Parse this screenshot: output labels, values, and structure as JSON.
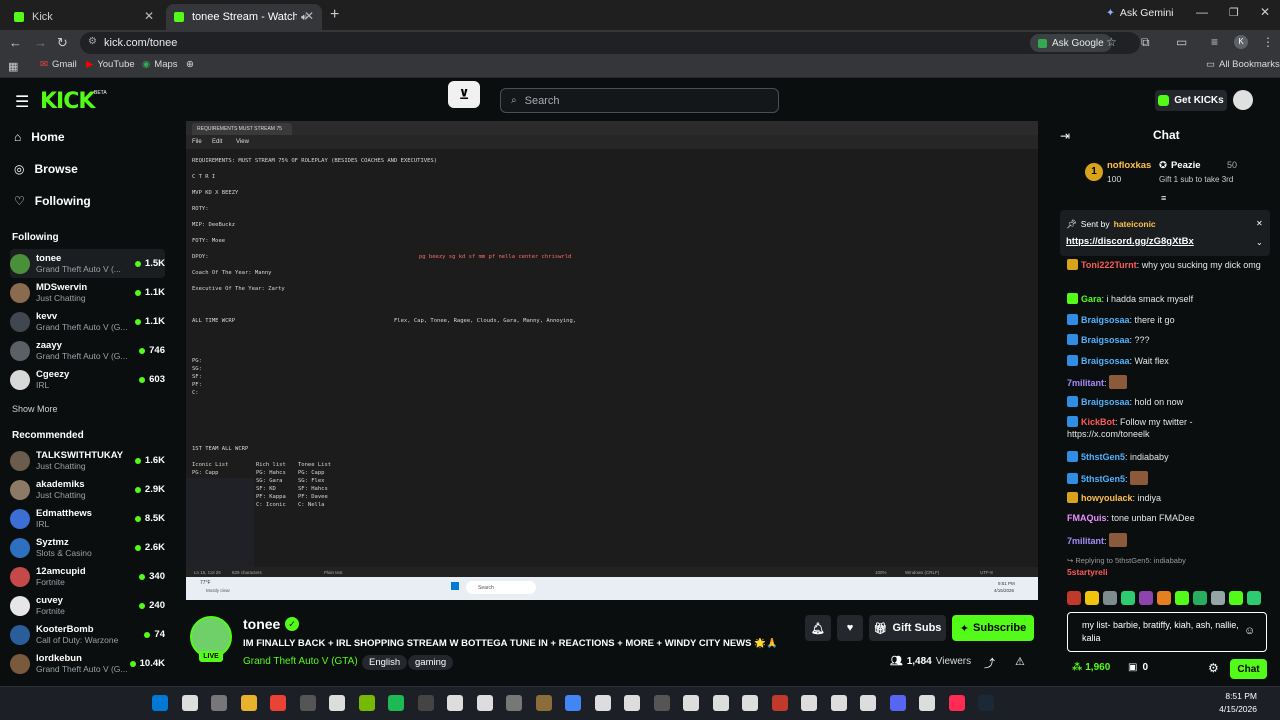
{
  "browser": {
    "tabs": [
      {
        "title": "Kick"
      },
      {
        "title": "tonee Stream - Watch Live"
      }
    ],
    "ask_gemini": "Ask Gemini",
    "url": "kick.com/tonee",
    "ask_google": "Ask Google",
    "bookmarks": [
      "Gmail",
      "YouTube",
      "Maps"
    ],
    "all_bookmarks": "All Bookmarks"
  },
  "kick": {
    "logo": "KICK",
    "logo_beta": "BETA",
    "search_placeholder": "Search",
    "get_kicks": "Get KICKs"
  },
  "sidebar": {
    "nav": [
      {
        "label": "Home",
        "icon": "home-icon"
      },
      {
        "label": "Browse",
        "icon": "compass-icon"
      },
      {
        "label": "Following",
        "icon": "heart-icon"
      }
    ],
    "following_header": "Following",
    "following": [
      {
        "name": "tonee",
        "game": "Grand Theft Auto V (...",
        "viewers": "1.5K",
        "color": "#4a8f3a"
      },
      {
        "name": "MDSwervin",
        "game": "Just Chatting",
        "viewers": "1.1K",
        "color": "#8a6b4e"
      },
      {
        "name": "kevv",
        "game": "Grand Theft Auto V (G...",
        "viewers": "1.1K",
        "color": "#3f4750"
      },
      {
        "name": "zaayy",
        "game": "Grand Theft Auto V (G...",
        "viewers": "746",
        "color": "#5b5f66"
      },
      {
        "name": "Cgeezy",
        "game": "IRL",
        "viewers": "603",
        "color": "#d8d8d8"
      }
    ],
    "show_more": "Show More",
    "recommended_header": "Recommended",
    "recommended": [
      {
        "name": "TALKSWITHTUKAY",
        "game": "Just Chatting",
        "viewers": "1.6K",
        "color": "#6b5c4d"
      },
      {
        "name": "akademiks",
        "game": "Just Chatting",
        "viewers": "2.9K",
        "color": "#8c7a66"
      },
      {
        "name": "Edmatthews",
        "game": "IRL",
        "viewers": "8.5K",
        "color": "#3b6fd4"
      },
      {
        "name": "Syztmz",
        "game": "Slots & Casino",
        "viewers": "2.6K",
        "color": "#2e6fc0"
      },
      {
        "name": "12amcupid",
        "game": "Fortnite",
        "viewers": "340",
        "color": "#c44a4a"
      },
      {
        "name": "cuvey",
        "game": "Fortnite",
        "viewers": "240",
        "color": "#e6e6e6"
      },
      {
        "name": "KooterBomb",
        "game": "Call of Duty: Warzone",
        "viewers": "74",
        "color": "#2a5d9c"
      },
      {
        "name": "lordkebun",
        "game": "Grand Theft Auto V (G...",
        "viewers": "10.4K",
        "color": "#7a5a3c"
      }
    ]
  },
  "stream_overlay": {
    "doc_title": "REQUIREMENTS MUST STREAM 75",
    "menu": [
      "File",
      "Edit",
      "View"
    ],
    "lines": [
      "REQUIREMENTS: MUST STREAM 75% OF ROLEPLAY (BESIDES COACHES AND EXECUTIVES)",
      "C T R I",
      "MVP KD X BEEZY",
      "ROTY:",
      "MIP: DeeBuckz",
      "FOTY: Moee",
      "DPOY:",
      "Coach Of The Year: Manny",
      "Executive Of The Year: Zarty",
      "ALL TIME WCRP",
      "PG:",
      "SG:",
      "SF:",
      "PF:",
      "C:",
      "1ST TEAM ALL WCRP"
    ],
    "dpoy_right": "pg beezy sg kd sf mm pf nella center chriswrld",
    "wcrp_right": "Flex, Cap, Tonee, Ragee, Clouds, Gara, Manny, Annoying,",
    "lists": [
      {
        "title": "Iconic List",
        "rows": [
          "PG: Capp",
          "SG: ...",
          "SF: ...",
          "PF: ...",
          "C: ..."
        ]
      },
      {
        "title": "Rich list",
        "rows": [
          "PG: Hahcs",
          "SG: Gara",
          "SF: KD",
          "PF: Kappa",
          "C: Iconic"
        ]
      },
      {
        "title": "Tonee List",
        "rows": [
          "PG: Capp",
          "SG: Flex",
          "SF: Hahcs",
          "PF: Davee",
          "C: Nella"
        ]
      }
    ],
    "status_left": "Ln 15, Col 26",
    "status_chars": "829 characters",
    "status_mid": "Plain text",
    "status_zoom": "100%",
    "status_eol": "Windows (CRLF)",
    "status_enc": "UTF-8",
    "weather": "77°F",
    "weather_desc": "Mostly clear",
    "win_search": "Search",
    "win_time": "9:51 PM",
    "win_date": "4/15/2026"
  },
  "stream": {
    "streamer": "tonee",
    "live": "LIVE",
    "title": "IM FINALLY BACK + IRL SHOPPING STREAM W BOTTEGA TUNE IN + REACTIONS + MORE + WINDY CITY NEWS 🌟🙏",
    "category": "Grand Theft Auto V (GTA)",
    "tags": [
      "English",
      "gaming"
    ],
    "viewers": "1,484",
    "viewers_label": "Viewers",
    "gift_subs": "Gift Subs",
    "subscribe": "Subscribe"
  },
  "chat": {
    "title": "Chat",
    "leaderboard": {
      "rank": "1",
      "user": "nofloxkas",
      "amount": "100",
      "peazie": "Peazie",
      "peazie_amount": "50",
      "gift_msg": "Gift 1 sub to take 3rd"
    },
    "pinned": {
      "label": "Sent by",
      "user": "hateiconic",
      "link": "https://discord.gg/zG8gXtBx"
    },
    "messages": [
      {
        "user": "Toni222Turnt",
        "color": "#ff5a5a",
        "text": "why you sucking my dick omg",
        "badge": "#d9a21b"
      },
      {
        "user": "Gara",
        "color": "#53fc18",
        "text": "i hadda smack myself",
        "badge": "#53fc18"
      },
      {
        "user": "Braigsosaa",
        "color": "#4fb3ff",
        "text": "there it go",
        "badge": "#2f8de4"
      },
      {
        "user": "Braigsosaa",
        "color": "#4fb3ff",
        "text": "???",
        "badge": "#2f8de4"
      },
      {
        "user": "Braigsosaa",
        "color": "#4fb3ff",
        "text": "Wait flex",
        "badge": "#2f8de4"
      },
      {
        "user": "7militant",
        "color": "#a78bfa",
        "text": "",
        "badge": ""
      },
      {
        "user": "Braigsosaa",
        "color": "#4fb3ff",
        "text": "hold on now",
        "badge": "#2f8de4"
      },
      {
        "user": "KickBot",
        "color": "#ff5a5a",
        "text": "Follow my twitter - https://x.com/toneelk",
        "badge": "#2f8de4"
      },
      {
        "user": "5thstGen5",
        "color": "#4fb3ff",
        "text": "indiababy",
        "badge": "#2f8de4"
      },
      {
        "user": "5thstGen5",
        "color": "#4fb3ff",
        "text": "",
        "badge": "#2f8de4"
      },
      {
        "user": "howyoulack",
        "color": "#ffc04d",
        "text": "indiya",
        "badge": "#d9a21b"
      },
      {
        "user": "FMAQuis",
        "color": "#e88fff",
        "text": "tone unban FMADee",
        "badge": ""
      },
      {
        "user": "7militant",
        "color": "#a78bfa",
        "text": "",
        "badge": ""
      }
    ],
    "reply_to": "Replying to 5thstGen5: indiababy",
    "reply_user": "5startyreli",
    "input_text": "my list- barbie, bratiffy, kiah, ash, nallie, kalia",
    "points": "1,960",
    "gift_count": "0",
    "send": "Chat"
  },
  "taskbar": {
    "time": "8:51 PM",
    "date": "4/15/2026"
  },
  "colors": {
    "accent": "#53fc18",
    "bg": "#0b0e0f"
  }
}
